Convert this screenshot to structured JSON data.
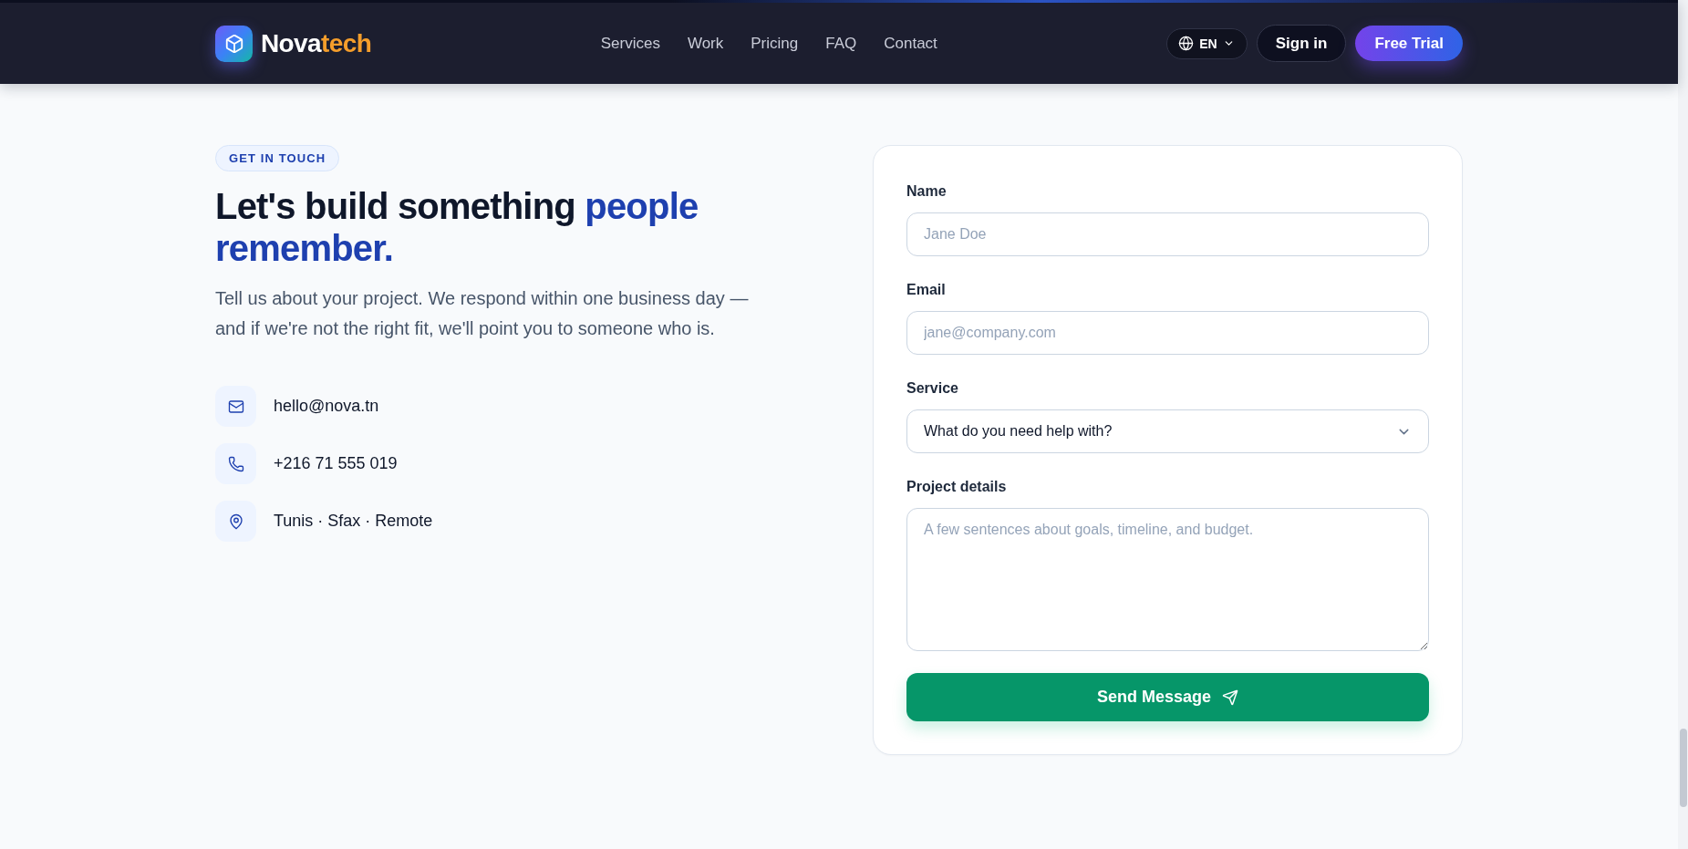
{
  "header": {
    "brand": {
      "name": "Nova",
      "accent": "tech"
    },
    "nav": [
      {
        "label": "Services"
      },
      {
        "label": "Work"
      },
      {
        "label": "Pricing"
      },
      {
        "label": "FAQ"
      },
      {
        "label": "Contact"
      }
    ],
    "language": {
      "code": "EN"
    },
    "sign_in": "Sign in",
    "cta": "Free Trial"
  },
  "intro": {
    "badge": "GET IN TOUCH",
    "heading": "Let's build something",
    "heading_highlight": "people remember.",
    "description": "Tell us about your project. We respond within one business day — and if we're not the right fit, we'll point you to someone who is.",
    "contacts": [
      {
        "kind": "email",
        "text": "hello@nova.tn"
      },
      {
        "kind": "phone",
        "text": "+216 71 555 019"
      },
      {
        "kind": "location",
        "text": "Tunis · Sfax · Remote"
      }
    ]
  },
  "form": {
    "fields": [
      {
        "kind": "input",
        "label": "Name",
        "placeholder": "Jane Doe"
      },
      {
        "kind": "input",
        "label": "Email",
        "placeholder": "jane@company.com"
      },
      {
        "kind": "select",
        "label": "Service",
        "value": "What do you need help with?"
      },
      {
        "kind": "textarea",
        "label": "Project details",
        "placeholder": "A few sentences about goals, timeline, and budget."
      }
    ],
    "submit": "Send Message"
  }
}
